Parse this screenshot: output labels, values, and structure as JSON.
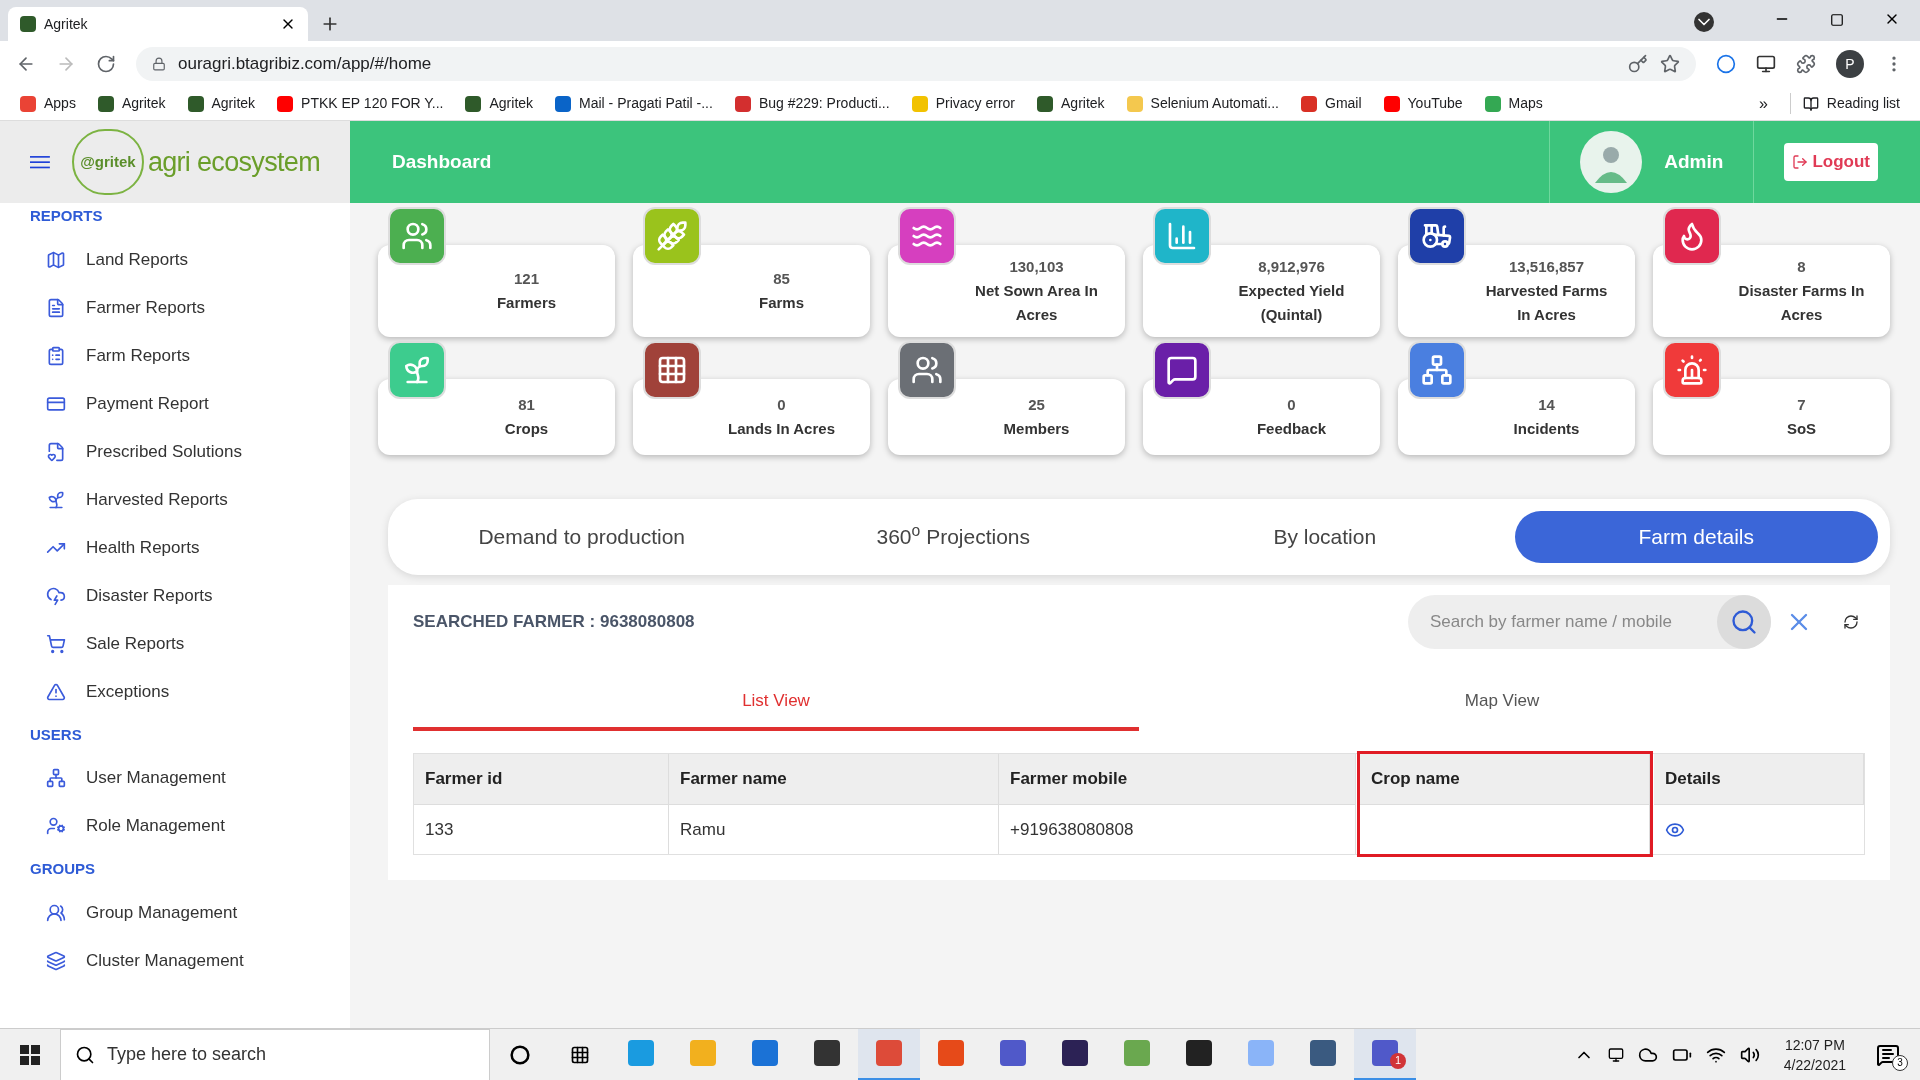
{
  "browser": {
    "tab_title": "Agritek",
    "url": "ouragri.btagribiz.com/app/#/home",
    "profile": "P",
    "bookmarks": [
      {
        "kind": "apps",
        "label": "Apps"
      },
      {
        "kind": "agritek",
        "label": "Agritek"
      },
      {
        "kind": "agritek",
        "label": "Agritek"
      },
      {
        "kind": "youtube",
        "label": "PTKK EP 120 FOR Y..."
      },
      {
        "kind": "agritek",
        "label": "Agritek"
      },
      {
        "kind": "outlook",
        "label": "Mail - Pragati Patil -..."
      },
      {
        "kind": "bug",
        "label": "Bug #229: Producti..."
      },
      {
        "kind": "privacy",
        "label": "Privacy error"
      },
      {
        "kind": "agritek",
        "label": "Agritek"
      },
      {
        "kind": "folder",
        "label": "Selenium Automati..."
      },
      {
        "kind": "gmail",
        "label": "Gmail"
      },
      {
        "kind": "youtube",
        "label": "YouTube"
      },
      {
        "kind": "maps",
        "label": "Maps"
      }
    ],
    "overflow": "»",
    "reading_list": "Reading list"
  },
  "logo": {
    "badge": "@gritek",
    "text": "agri ecosystem"
  },
  "header": {
    "title": "Dashboard",
    "user": "Admin",
    "logout": "Logout"
  },
  "sidebar": [
    {
      "title": "REPORTS",
      "items": [
        {
          "label": "Land Reports"
        },
        {
          "label": "Farmer Reports"
        },
        {
          "label": "Farm Reports"
        },
        {
          "label": "Payment Report"
        },
        {
          "label": "Prescribed Solutions"
        },
        {
          "label": "Harvested Reports"
        },
        {
          "label": "Health Reports"
        },
        {
          "label": "Disaster Reports"
        },
        {
          "label": "Sale Reports"
        },
        {
          "label": "Exceptions"
        }
      ]
    },
    {
      "title": "USERS",
      "items": [
        {
          "label": "User Management"
        },
        {
          "label": "Role Management"
        }
      ]
    },
    {
      "title": "GROUPS",
      "items": [
        {
          "label": "Group Management"
        },
        {
          "label": "Cluster Management"
        }
      ]
    }
  ],
  "stats": [
    {
      "value": "121",
      "label": "Farmers",
      "color": "#4caf50"
    },
    {
      "value": "85",
      "label": "Farms",
      "color": "#9ac31c"
    },
    {
      "value": "130,103",
      "label": "Net Sown Area In Acres",
      "color": "#d63fbf"
    },
    {
      "value": "8,912,976",
      "label": "Expected Yield (Quintal)",
      "color": "#1fb5c9"
    },
    {
      "value": "13,516,857",
      "label": "Harvested Farms In Acres",
      "color": "#1f3fa8"
    },
    {
      "value": "8",
      "label": "Disaster Farms In Acres",
      "color": "#e0284f"
    },
    {
      "value": "81",
      "label": "Crops",
      "color": "#3dcc8e"
    },
    {
      "value": "0",
      "label": "Lands In Acres",
      "color": "#a0423a"
    },
    {
      "value": "25",
      "label": "Members",
      "color": "#6b6f75"
    },
    {
      "value": "0",
      "label": "Feedback",
      "color": "#6a1fa8"
    },
    {
      "value": "14",
      "label": "Incidents",
      "color": "#4a7fe0"
    },
    {
      "value": "7",
      "label": "SoS",
      "color": "#f03a3a"
    }
  ],
  "tabs": [
    {
      "label": "Demand to production",
      "selected": false
    },
    {
      "label": "360$^{o}$ Projections",
      "selected": false
    },
    {
      "label": "By location",
      "selected": false
    },
    {
      "label": "Farm details",
      "selected": true
    }
  ],
  "search": {
    "title": "SEARCHED FARMER : 9638080808",
    "placeholder": "Search by farmer name / mobile"
  },
  "view_tabs": [
    {
      "label": "List View",
      "selected": true
    },
    {
      "label": "Map View",
      "selected": false
    }
  ],
  "table": {
    "columns": [
      {
        "label": "Farmer id",
        "highlighted": false
      },
      {
        "label": "Farmer name",
        "highlighted": false
      },
      {
        "label": "Farmer mobile",
        "highlighted": false
      },
      {
        "label": "Crop name",
        "highlighted": true
      },
      {
        "label": "Details",
        "highlighted": false
      }
    ],
    "rows": [
      {
        "cells": [
          "133",
          "Ramu",
          "+919638080808",
          ""
        ],
        "details": true
      }
    ]
  },
  "taskbar": {
    "search_placeholder": "Type here to search",
    "apps": [
      {
        "kind": "edge",
        "active": false
      },
      {
        "kind": "files",
        "active": false
      },
      {
        "kind": "mail",
        "active": false
      },
      {
        "kind": "store",
        "active": false
      },
      {
        "kind": "chrome",
        "active": true
      },
      {
        "kind": "office",
        "active": false
      },
      {
        "kind": "teams",
        "active": false
      },
      {
        "kind": "eclipse",
        "active": false
      },
      {
        "kind": "notepad",
        "active": false
      },
      {
        "kind": "sticky",
        "active": false
      },
      {
        "kind": "paint",
        "active": false
      },
      {
        "kind": "snip",
        "active": false
      },
      {
        "kind": "teams",
        "active": true,
        "badge": "1"
      }
    ],
    "time": "12:07 PM",
    "date": "4/22/2021",
    "notifications": "3"
  }
}
